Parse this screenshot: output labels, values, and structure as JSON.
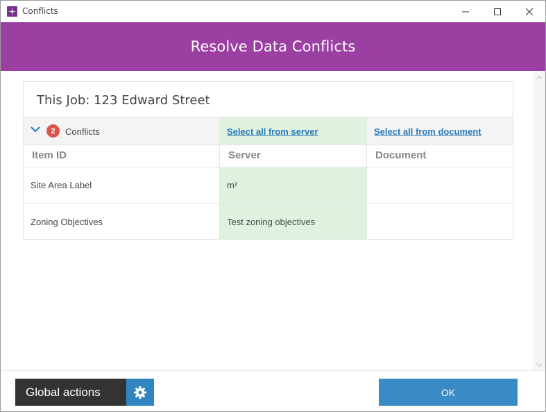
{
  "window": {
    "title": "Conflicts",
    "app_icon": "app-logo-icon",
    "controls": [
      "minimize-icon",
      "maximize-icon",
      "close-icon"
    ]
  },
  "header": {
    "title": "Resolve Data Conflicts",
    "background_color": "#9b3fa2"
  },
  "card": {
    "job_title": "This Job: 123 Edward Street",
    "conflict_count": "2",
    "conflicts_label": "Conflicts",
    "select_all_server": "Select all from server",
    "select_all_document": "Select all from document",
    "columns": [
      "Item ID",
      "Server",
      "Document"
    ],
    "rows": [
      {
        "item_id": "Site Area Label",
        "server": "m²",
        "document": ""
      },
      {
        "item_id": "Zoning Objectives",
        "server": "Test zoning objectives",
        "document": ""
      }
    ]
  },
  "footer": {
    "global_actions_label": "Global actions",
    "ok_label": "OK"
  },
  "colors": {
    "accent": "#3a8bc4",
    "server_highlight": "#dff2df",
    "badge": "#d9534f"
  }
}
